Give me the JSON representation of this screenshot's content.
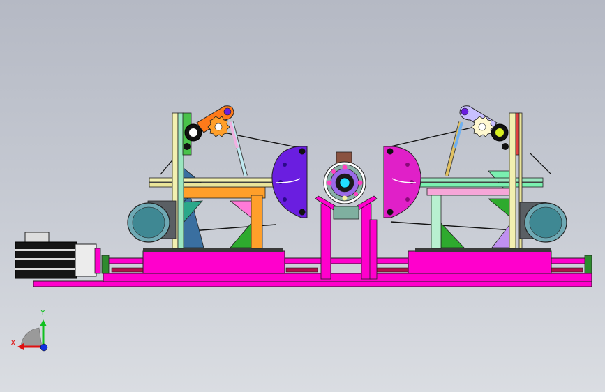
{
  "colors": {
    "bg_top": "#b5b9c4",
    "bg_bottom": "#dadde2",
    "base_magenta": "#ff00cc",
    "frame_yellow": "#f2f0b0",
    "frame_green": "#9be6c0",
    "motor_teal": "#6fa9b4",
    "arm_orange": "#ff7a1a",
    "arm_lavender": "#c8c0ff",
    "clamp_purple": "#6a1ee0",
    "clamp_magenta": "#e020c8",
    "beam_orange": "#ff9f2a",
    "axis_red": "#e01010",
    "axis_green": "#10c020",
    "axis_blue": "#1030e0"
  },
  "triad": {
    "y_label": "Y",
    "x_label": "X"
  }
}
